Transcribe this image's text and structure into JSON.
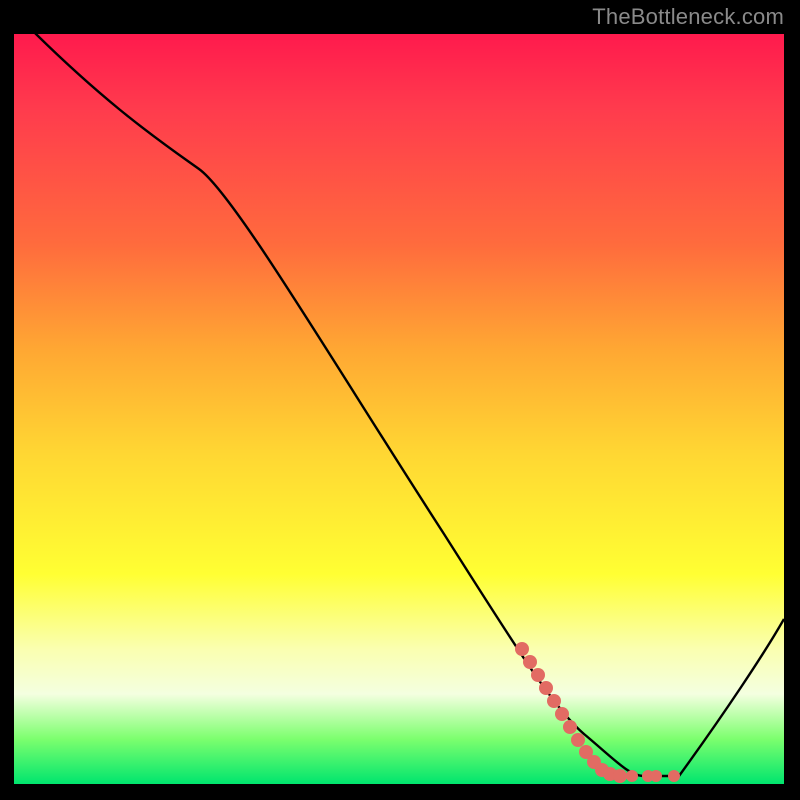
{
  "watermark": "TheBottleneck.com",
  "chart_data": {
    "type": "line",
    "title": "",
    "xlabel": "",
    "ylabel": "",
    "xlim": [
      0,
      100
    ],
    "ylim": [
      0,
      100
    ],
    "series": [
      {
        "name": "bottleneck-curve",
        "x": [
          0,
          24,
          74,
          80,
          86,
          100
        ],
        "y": [
          103,
          82,
          7,
          1,
          1,
          22
        ]
      }
    ],
    "highlight_segment": {
      "name": "salmon-dotted-region",
      "x": [
        66,
        70,
        73,
        76,
        79,
        82,
        84,
        86
      ],
      "y": [
        18,
        12,
        7,
        3,
        1,
        1,
        1,
        1
      ]
    },
    "gradient_stops": [
      {
        "pos": 0,
        "color": "#ff1a4d"
      },
      {
        "pos": 28,
        "color": "#ff6b3d"
      },
      {
        "pos": 56,
        "color": "#ffd733"
      },
      {
        "pos": 82,
        "color": "#faffb0"
      },
      {
        "pos": 100,
        "color": "#00e56e"
      }
    ]
  }
}
